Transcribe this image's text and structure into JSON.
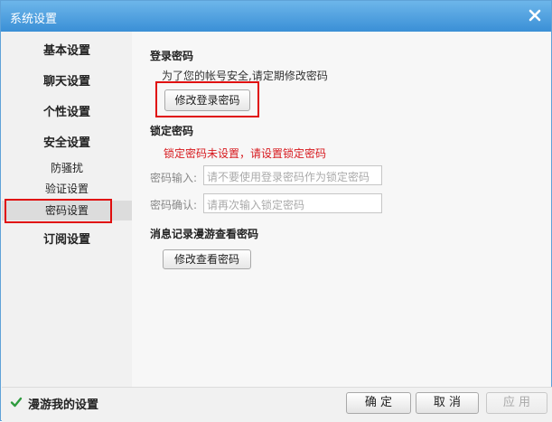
{
  "window": {
    "title": "系统设置"
  },
  "sidebar": {
    "items": [
      {
        "label": "基本设置"
      },
      {
        "label": "聊天设置"
      },
      {
        "label": "个性设置"
      },
      {
        "label": "安全设置"
      },
      {
        "label": "防骚扰"
      },
      {
        "label": "验证设置"
      },
      {
        "label": "密码设置",
        "selected": true
      },
      {
        "label": "订阅设置"
      }
    ]
  },
  "login_password": {
    "title": "登录密码",
    "description": "为了您的帐号安全,请定期修改密码",
    "button": "修改登录密码"
  },
  "lock_password": {
    "title": "锁定密码",
    "warning": "锁定密码未设置，请设置锁定密码",
    "input_label": "密码输入:",
    "input_placeholder": "请不要使用登录密码作为锁定密码",
    "confirm_label": "密码确认:",
    "confirm_placeholder": "请再次输入锁定密码"
  },
  "message_record": {
    "title": "消息记录漫游查看密码",
    "button": "修改查看密码"
  },
  "footer": {
    "roam_label": "漫游我的设置",
    "roam_checked": true,
    "ok": "确 定",
    "cancel": "取 消",
    "apply": "应 用"
  },
  "colors": {
    "titlebar": "#4a9fe0",
    "highlight": "#e00d0d",
    "warning": "#d7191e",
    "checkmark": "#2e9b3e"
  },
  "icons": {
    "close": "close-icon",
    "check": "checkmark-icon"
  }
}
